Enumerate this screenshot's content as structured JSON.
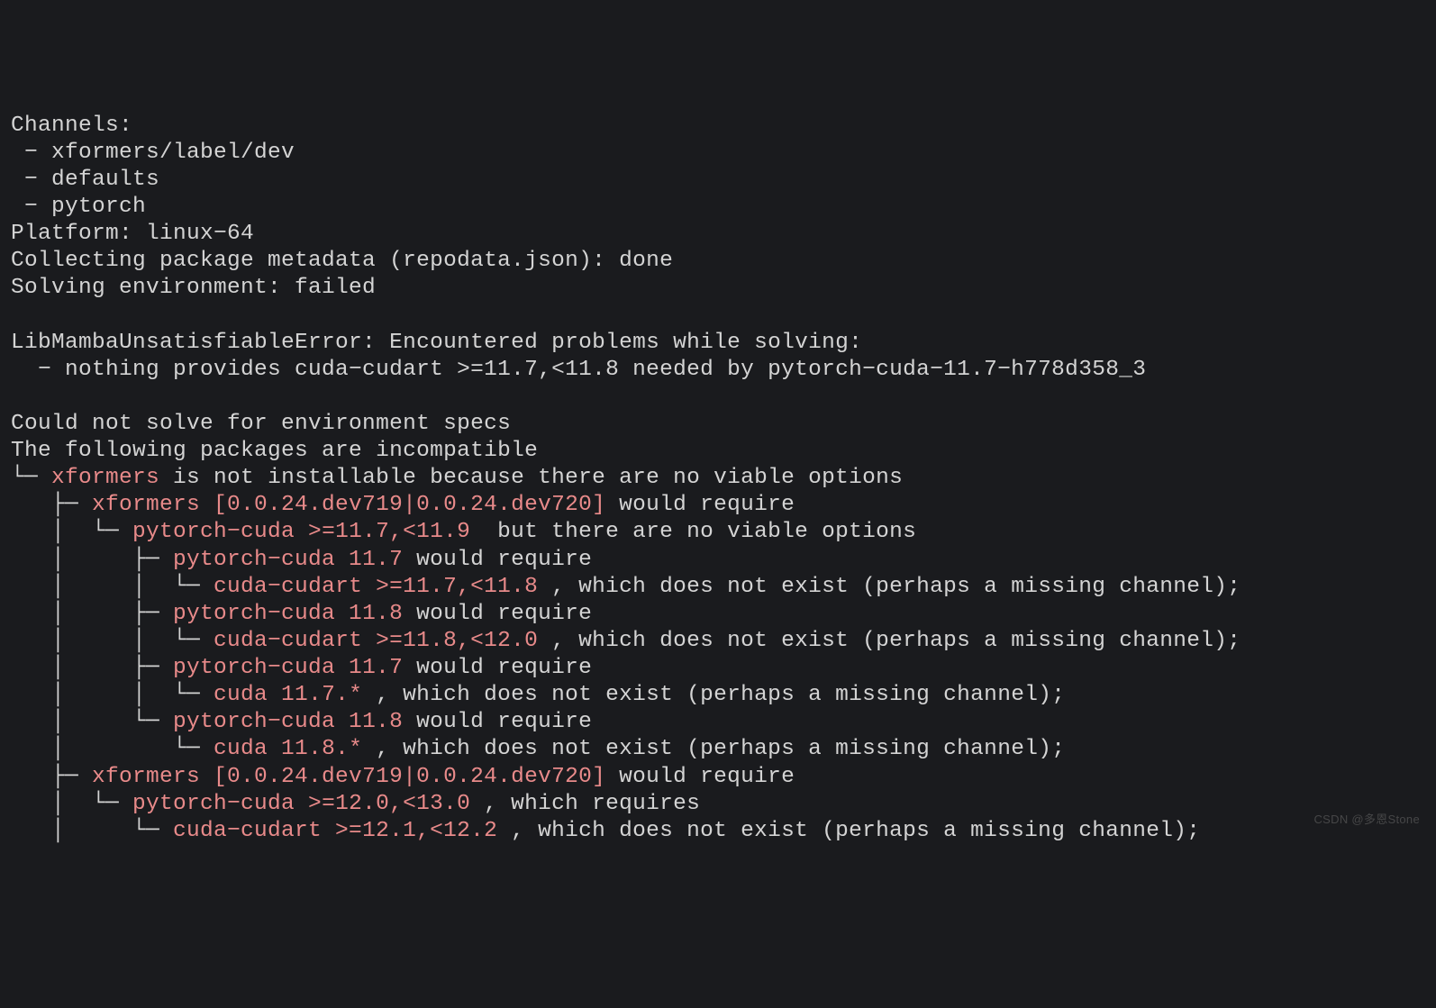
{
  "lines": [
    {
      "segs": [
        {
          "t": "Channels:"
        }
      ]
    },
    {
      "segs": [
        {
          "t": " − xformers/label/dev"
        }
      ]
    },
    {
      "segs": [
        {
          "t": " − defaults"
        }
      ]
    },
    {
      "segs": [
        {
          "t": " − pytorch"
        }
      ]
    },
    {
      "segs": [
        {
          "t": "Platform: linux−64"
        }
      ]
    },
    {
      "segs": [
        {
          "t": "Collecting package metadata (repodata.json): done"
        }
      ]
    },
    {
      "segs": [
        {
          "t": "Solving environment: failed"
        }
      ]
    },
    {
      "segs": [
        {
          "t": " "
        }
      ]
    },
    {
      "segs": [
        {
          "t": "LibMambaUnsatisfiableError: Encountered problems while solving:"
        }
      ]
    },
    {
      "segs": [
        {
          "t": "  − nothing provides cuda−cudart >=11.7,<11.8 needed by pytorch−cuda−11.7−h778d358_3"
        }
      ]
    },
    {
      "segs": [
        {
          "t": " "
        }
      ]
    },
    {
      "segs": [
        {
          "t": "Could not solve for environment specs"
        }
      ]
    },
    {
      "segs": [
        {
          "t": "The following packages are incompatible"
        }
      ]
    },
    {
      "segs": [
        {
          "t": "└─ "
        },
        {
          "t": "xformers",
          "hl": true
        },
        {
          "t": " is not installable because there are no viable options"
        }
      ]
    },
    {
      "segs": [
        {
          "t": "   ├─ "
        },
        {
          "t": "xformers [0.0.24.dev719|0.0.24.dev720]",
          "hl": true
        },
        {
          "t": " would require"
        }
      ]
    },
    {
      "segs": [
        {
          "t": "   │  └─ "
        },
        {
          "t": "pytorch−cuda >=11.7,<11.9 ",
          "hl": true
        },
        {
          "t": " but there are no viable options"
        }
      ]
    },
    {
      "segs": [
        {
          "t": "   │     ├─ "
        },
        {
          "t": "pytorch−cuda 11.7",
          "hl": true
        },
        {
          "t": " would require"
        }
      ]
    },
    {
      "segs": [
        {
          "t": "   │     │  └─ "
        },
        {
          "t": "cuda−cudart >=11.7,<11.8 ",
          "hl": true
        },
        {
          "t": ", which does not exist (perhaps a missing channel);"
        }
      ]
    },
    {
      "segs": [
        {
          "t": "   │     ├─ "
        },
        {
          "t": "pytorch−cuda 11.8",
          "hl": true
        },
        {
          "t": " would require"
        }
      ]
    },
    {
      "segs": [
        {
          "t": "   │     │  └─ "
        },
        {
          "t": "cuda−cudart >=11.8,<12.0 ",
          "hl": true
        },
        {
          "t": ", which does not exist (perhaps a missing channel);"
        }
      ]
    },
    {
      "segs": [
        {
          "t": "   │     ├─ "
        },
        {
          "t": "pytorch−cuda 11.7",
          "hl": true
        },
        {
          "t": " would require"
        }
      ]
    },
    {
      "segs": [
        {
          "t": "   │     │  └─ "
        },
        {
          "t": "cuda 11.7.* ",
          "hl": true
        },
        {
          "t": ", which does not exist (perhaps a missing channel);"
        }
      ]
    },
    {
      "segs": [
        {
          "t": "   │     └─ "
        },
        {
          "t": "pytorch−cuda 11.8",
          "hl": true
        },
        {
          "t": " would require"
        }
      ]
    },
    {
      "segs": [
        {
          "t": "   │        └─ "
        },
        {
          "t": "cuda 11.8.* ",
          "hl": true
        },
        {
          "t": ", which does not exist (perhaps a missing channel);"
        }
      ]
    },
    {
      "segs": [
        {
          "t": "   ├─ "
        },
        {
          "t": "xformers [0.0.24.dev719|0.0.24.dev720]",
          "hl": true
        },
        {
          "t": " would require"
        }
      ]
    },
    {
      "segs": [
        {
          "t": "   │  └─ "
        },
        {
          "t": "pytorch−cuda >=12.0,<13.0 ",
          "hl": true
        },
        {
          "t": ", which requires"
        }
      ]
    },
    {
      "segs": [
        {
          "t": "   │     └─ "
        },
        {
          "t": "cuda−cudart >=12.1,<12.2 ",
          "hl": true
        },
        {
          "t": ", which does not exist (perhaps a missing channel);"
        }
      ]
    }
  ],
  "watermark": "CSDN @多恩Stone"
}
